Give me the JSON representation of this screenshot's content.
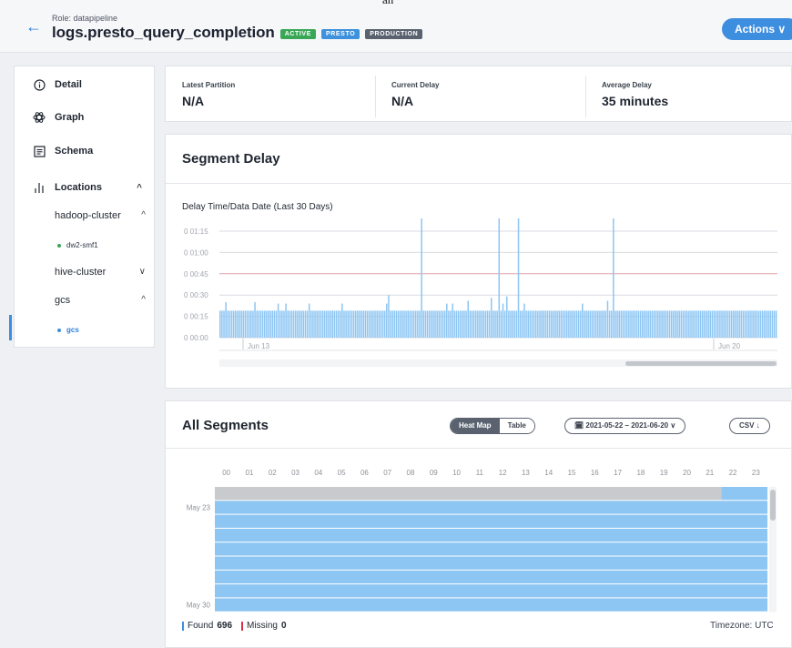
{
  "top_fragment": "an",
  "header": {
    "role": "Role: datapipeline",
    "title": "logs.presto_query_completion",
    "tags": [
      "ACTIVE",
      "PRESTO",
      "PRODUCTION"
    ],
    "actions_label": "Actions ∨"
  },
  "sidebar": {
    "items": [
      {
        "label": "Detail",
        "icon": "info-icon"
      },
      {
        "label": "Graph",
        "icon": "graph-icon"
      },
      {
        "label": "Schema",
        "icon": "schema-icon"
      },
      {
        "label": "Locations",
        "icon": "locations-icon"
      }
    ],
    "locations": [
      {
        "label": "hadoop-cluster",
        "caret": "^"
      },
      {
        "label": "hive-cluster",
        "caret": "∨"
      },
      {
        "label": "gcs",
        "caret": "^"
      }
    ],
    "subs": [
      {
        "label": "dw2-smf1"
      },
      {
        "label": "gcs"
      }
    ],
    "locations_caret": "^"
  },
  "stats": {
    "latest_partition_label": "Latest Partition",
    "latest_partition_value": "N/A",
    "current_delay_label": "Current Delay",
    "current_delay_value": "N/A",
    "average_delay_label": "Average Delay",
    "average_delay_value": "35 minutes"
  },
  "segment_delay": {
    "title": "Segment Delay",
    "chart_title": "Delay Time/Data Date (Last 30 Days)"
  },
  "chart_data": {
    "type": "bar",
    "title": "Delay Time/Data Date (Last 30 Days)",
    "y_tick_labels": [
      "0 00:00",
      "0 00:15",
      "0 00:30",
      "0 00:45",
      "0 01:00",
      "0 01:15"
    ],
    "x_tick_labels": [
      "Jun 13",
      "Jun 20"
    ],
    "ylim_minutes": [
      0,
      90
    ],
    "grid": true,
    "series": [
      {
        "values_minutes": [
          19,
          19,
          19,
          25,
          19,
          19,
          19,
          19,
          19,
          19,
          19,
          19,
          19,
          19,
          19,
          19,
          19,
          19,
          25,
          19,
          19,
          19,
          19,
          19,
          19,
          19,
          19,
          19,
          19,
          19,
          19,
          19,
          19,
          19,
          24,
          19,
          19,
          19,
          19,
          19,
          19,
          19,
          19,
          19,
          19,
          19,
          24,
          19,
          19,
          19,
          19,
          19,
          19,
          19,
          19,
          19,
          19,
          19,
          19,
          19,
          19,
          19,
          19,
          24,
          19,
          19,
          19,
          19,
          19,
          19,
          19,
          19,
          19,
          19,
          19,
          19,
          19,
          19,
          19,
          19,
          19,
          19,
          19,
          19,
          19,
          19,
          24,
          19,
          19,
          19,
          19,
          19,
          19,
          19,
          19,
          19,
          19,
          19,
          19,
          19,
          19,
          19,
          19,
          19,
          19,
          19,
          19,
          19,
          19,
          19,
          19,
          19,
          19,
          19,
          19,
          19,
          19,
          19,
          19,
          19,
          24,
          19,
          19,
          19,
          19,
          19,
          19,
          19,
          19,
          19,
          19,
          19,
          19,
          19,
          19,
          19,
          19,
          19,
          19,
          19,
          19,
          19,
          19,
          19,
          19,
          19,
          24,
          19,
          19,
          19,
          19,
          19,
          19,
          19,
          19,
          19,
          19,
          19,
          19,
          19,
          19,
          19,
          19,
          19,
          19,
          19,
          19,
          19,
          19,
          19,
          19,
          19,
          19,
          19,
          19,
          19,
          19,
          19,
          19,
          19,
          19,
          19,
          19,
          19,
          19,
          19,
          19,
          19,
          19,
          19,
          19,
          19,
          19,
          19,
          19,
          19,
          19,
          19,
          19,
          19,
          19,
          19,
          19,
          19,
          19,
          19,
          19,
          19,
          19,
          19,
          19,
          19,
          19,
          19,
          19,
          19,
          19,
          19,
          19,
          19,
          19,
          19,
          19,
          19,
          19,
          19,
          19,
          19,
          19,
          19,
          19,
          19,
          19,
          19,
          19,
          19,
          19,
          19,
          19,
          19,
          19,
          19,
          19,
          19,
          19,
          19,
          19,
          19,
          19,
          19,
          19,
          19,
          19,
          19,
          19,
          19,
          19,
          19,
          19,
          19,
          19,
          19,
          19,
          19,
          19,
          19,
          19,
          19,
          19,
          19,
          19,
          19,
          19,
          19,
          19,
          19,
          19,
          19,
          19,
          19,
          19,
          19,
          19,
          19,
          19,
          19,
          19,
          19
        ]
      }
    ],
    "spikes_minutes": [
      {
        "i": 104,
        "v": 84
      },
      {
        "i": 144,
        "v": 84
      },
      {
        "i": 154,
        "v": 84
      },
      {
        "i": 203,
        "v": 84
      },
      {
        "i": 18,
        "v": 25
      },
      {
        "i": 30,
        "v": 24
      },
      {
        "i": 87,
        "v": 30
      },
      {
        "i": 117,
        "v": 24
      },
      {
        "i": 128,
        "v": 26
      },
      {
        "i": 140,
        "v": 28
      },
      {
        "i": 148,
        "v": 29
      },
      {
        "i": 157,
        "v": 24
      },
      {
        "i": 187,
        "v": 24
      },
      {
        "i": 200,
        "v": 26
      }
    ]
  },
  "all_segments": {
    "title": "All Segments",
    "view_heatmap": "Heat Map",
    "view_table": "Table",
    "date_range": "🗓 2021-05-22 – 2021-06-20 ∨",
    "csv_label": "CSV ↓",
    "hours": [
      "00",
      "01",
      "02",
      "03",
      "04",
      "05",
      "06",
      "07",
      "08",
      "09",
      "10",
      "11",
      "12",
      "13",
      "14",
      "15",
      "16",
      "17",
      "18",
      "19",
      "20",
      "21",
      "22",
      "23"
    ],
    "row_labels": [
      "May 23",
      "May 30"
    ],
    "found_label": "Found",
    "found_count": "696",
    "missing_label": "Missing",
    "missing_count": "0",
    "timezone": "Timezone: UTC",
    "colors": {
      "found": "#8ec6f3",
      "missing": "#c8cacd"
    }
  },
  "colors": {
    "accent": "#3e8ee0",
    "bar": "#8ec6f3",
    "active": "#3aa757"
  }
}
